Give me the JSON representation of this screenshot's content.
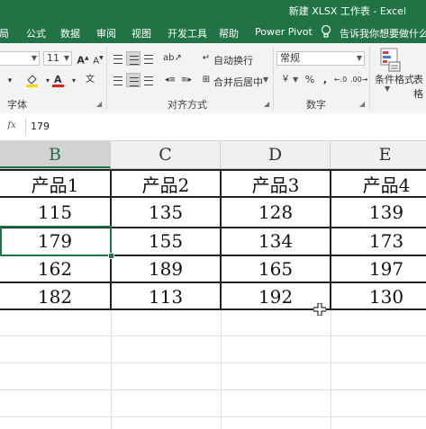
{
  "window": {
    "title": "新建 XLSX 工作表 - Excel"
  },
  "tabs": [
    "局",
    "公式",
    "数据",
    "审阅",
    "视图",
    "开发工具",
    "帮助",
    "Power Pivot"
  ],
  "tell_me": "告诉我你想要做什么",
  "ribbon": {
    "font_size": "11",
    "grow_font": "A",
    "shrink_font": "A",
    "wrap_text": "自动换行",
    "merge_center": "合并后居中",
    "number_format": "常规",
    "percent": "%",
    "comma": ",",
    "conditional_format": "条件格式",
    "table_format_partial": "表格",
    "group_font": "字体",
    "group_align": "对齐方式",
    "group_number": "数字"
  },
  "formula_bar": {
    "fx": "fx",
    "value": "179"
  },
  "grid": {
    "columns": [
      "B",
      "C",
      "D",
      "E"
    ],
    "header_row": [
      "产品1",
      "产品2",
      "产品3",
      "产品4"
    ],
    "rows": [
      [
        "115",
        "135",
        "128",
        "139"
      ],
      [
        "179",
        "155",
        "134",
        "173"
      ],
      [
        "162",
        "189",
        "165",
        "197"
      ],
      [
        "182",
        "113",
        "192",
        "130"
      ]
    ],
    "active_column": "B",
    "selected_value": "179"
  },
  "colors": {
    "accent": "#217346"
  },
  "icons": {
    "tell_me": "lightbulb-icon",
    "fill": "fill-color-icon",
    "font_color": "font-color-icon",
    "cursor": "cross-cursor-icon"
  }
}
